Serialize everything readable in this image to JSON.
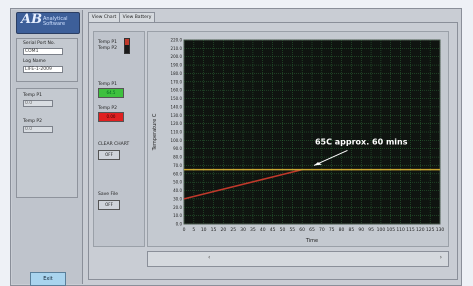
{
  "app": {
    "logo_text": "AB",
    "logo_sub": "Analytical Software"
  },
  "left": {
    "serial_label": "Serial Port No.",
    "serial_value": "COM1",
    "log_name_label": "Log Name",
    "log_name_value": "LIFE-1-2009",
    "temp1_label": "Temp P1",
    "temp1_value": "0.0",
    "temp2_label": "Temp P2",
    "temp2_value": "0.0",
    "exit_label": "Exit"
  },
  "tabs": [
    {
      "label": "View Chart"
    },
    {
      "label": "View Battery"
    }
  ],
  "controls": {
    "temp_p1_label": "Temp P1",
    "temp_p2_label": "Temp P2",
    "temp_p1_led": "64.5",
    "temp_p2_led": "0.00",
    "clear_chart_label": "CLEAR CHART",
    "clear_chart_btn": "OFF",
    "save_file_label": "Save File",
    "save_file_btn": "OFF"
  },
  "chart_data": {
    "type": "line",
    "title": "",
    "annotation": "65C approx. 60 mins",
    "xlabel": "Time",
    "ylabel": "Temperature C",
    "xlim": [
      0,
      130
    ],
    "ylim": [
      0,
      220
    ],
    "x_ticks": [
      0,
      5,
      10,
      15,
      20,
      25,
      30,
      35,
      40,
      45,
      50,
      55,
      60,
      65,
      70,
      75,
      80,
      85,
      90,
      95,
      100,
      105,
      110,
      115,
      120,
      125,
      130
    ],
    "y_ticks": [
      0,
      10,
      20,
      30,
      40,
      50,
      60,
      70,
      80,
      90,
      100,
      110,
      120,
      130,
      140,
      150,
      160,
      170,
      180,
      190,
      200,
      210,
      220
    ],
    "series": [
      {
        "color": "#c0392b",
        "x": [
          0,
          60
        ],
        "y": [
          30,
          65
        ]
      },
      {
        "color": "#c8a530",
        "x": [
          0,
          130
        ],
        "y": [
          65,
          65
        ]
      }
    ],
    "colors": {
      "plot_bg": "#0f1410",
      "grid": "#2f6f3a"
    }
  }
}
